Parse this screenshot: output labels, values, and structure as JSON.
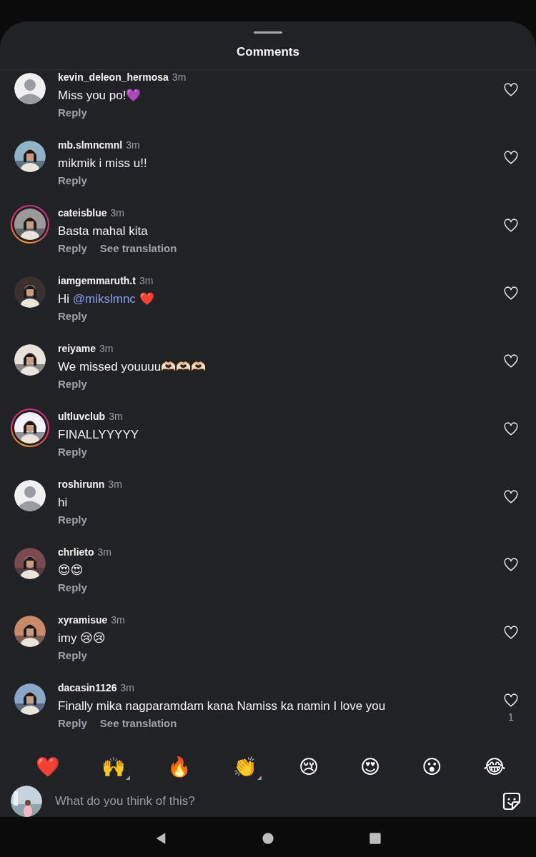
{
  "sheet": {
    "title": "Comments"
  },
  "comments": [
    {
      "username": "kevin_deleon_hermosa",
      "time": "3m",
      "avatar": {
        "kind": "default",
        "story_ring": false
      },
      "segments": [
        {
          "kind": "text",
          "text": "Miss you po!💜"
        }
      ],
      "actions": [
        "Reply"
      ]
    },
    {
      "username": "mb.slmncmnl",
      "time": "3m",
      "avatar": {
        "kind": "picture",
        "story_ring": false,
        "color": "#8fb3c9"
      },
      "segments": [
        {
          "kind": "text",
          "text": "mikmik i miss u!!"
        }
      ],
      "actions": [
        "Reply"
      ]
    },
    {
      "username": "cateisblue",
      "time": "3m",
      "avatar": {
        "kind": "picture",
        "story_ring": true,
        "color": "#9a9a9a"
      },
      "segments": [
        {
          "kind": "text",
          "text": "Basta mahal kita"
        }
      ],
      "actions": [
        "Reply",
        "See translation"
      ]
    },
    {
      "username": "iamgemmaruth.t",
      "time": "3m",
      "avatar": {
        "kind": "picture",
        "story_ring": false,
        "color": "#3a3030"
      },
      "segments": [
        {
          "kind": "text",
          "text": "Hi "
        },
        {
          "kind": "mention",
          "text": "@mikslmnc"
        },
        {
          "kind": "text",
          "text": " ❤️"
        }
      ],
      "actions": [
        "Reply"
      ]
    },
    {
      "username": "reiyame",
      "time": "3m",
      "avatar": {
        "kind": "picture",
        "story_ring": false,
        "color": "#e8e2da"
      },
      "segments": [
        {
          "kind": "text",
          "text": "We missed youuuu🫶🏻🫶🏻🫶🏻"
        }
      ],
      "actions": [
        "Reply"
      ]
    },
    {
      "username": "ultluvclub",
      "time": "3m",
      "avatar": {
        "kind": "picture",
        "story_ring": true,
        "color": "#f4f2fa"
      },
      "segments": [
        {
          "kind": "text",
          "text": "FINALLYYYYY"
        }
      ],
      "actions": [
        "Reply"
      ]
    },
    {
      "username": "roshirunn",
      "time": "3m",
      "avatar": {
        "kind": "default",
        "story_ring": false
      },
      "segments": [
        {
          "kind": "text",
          "text": "hi"
        }
      ],
      "actions": [
        "Reply"
      ]
    },
    {
      "username": "chrlieto",
      "time": "3m",
      "avatar": {
        "kind": "picture",
        "story_ring": false,
        "color": "#7a4a50"
      },
      "segments": [
        {
          "kind": "text",
          "text": "😍😍"
        }
      ],
      "actions": [
        "Reply"
      ]
    },
    {
      "username": "xyramisue",
      "time": "3m",
      "avatar": {
        "kind": "picture",
        "story_ring": false,
        "color": "#c98a6a"
      },
      "segments": [
        {
          "kind": "text",
          "text": "imy 😢😢"
        }
      ],
      "actions": [
        "Reply"
      ]
    },
    {
      "username": "dacasin1126",
      "time": "3m",
      "avatar": {
        "kind": "picture",
        "story_ring": false,
        "color": "#8aa6c8"
      },
      "segments": [
        {
          "kind": "text",
          "text": "Finally mika nagparamdam kana Namiss ka namin I love you"
        }
      ],
      "actions": [
        "Reply",
        "See translation"
      ],
      "like_count": "1"
    }
  ],
  "reactions": [
    {
      "emoji": "❤️",
      "variants": false
    },
    {
      "emoji": "🙌",
      "variants": true
    },
    {
      "emoji": "🔥",
      "variants": false
    },
    {
      "emoji": "👏",
      "variants": true
    },
    {
      "emoji": "😢",
      "variants": false
    },
    {
      "emoji": "😍",
      "variants": false
    },
    {
      "emoji": "😮",
      "variants": false
    },
    {
      "emoji": "😂",
      "variants": false
    }
  ],
  "composer": {
    "placeholder": "What do you think of this?"
  }
}
